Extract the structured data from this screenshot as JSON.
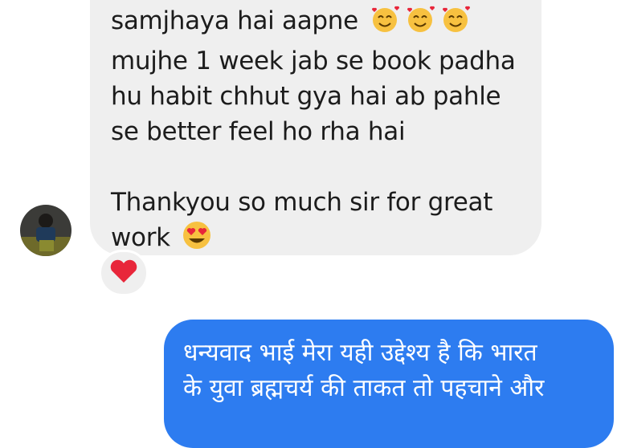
{
  "incoming_message": {
    "lines": [
      "samjhaya hai aapne",
      "mujhe 1 week jab se book padha",
      "hu habit chhut gya hai ab pahle",
      "se better feel ho rha hai",
      "",
      "Thankyou so much sir for great",
      "work"
    ],
    "emoji_line1": "smiling-face-with-hearts x3",
    "emoji_last": "heart-eyes",
    "reaction": "red-heart"
  },
  "outgoing_message": {
    "lines": [
      "धन्यवाद भाई मेरा यही उद्देश्य है कि भारत",
      "के युवा ब्रह्मचर्य की ताकत तो पहचाने और"
    ]
  },
  "colors": {
    "incoming_bubble": "#efefef",
    "outgoing_bubble": "#2d7cf0",
    "reaction_heart": "#e8263a"
  }
}
